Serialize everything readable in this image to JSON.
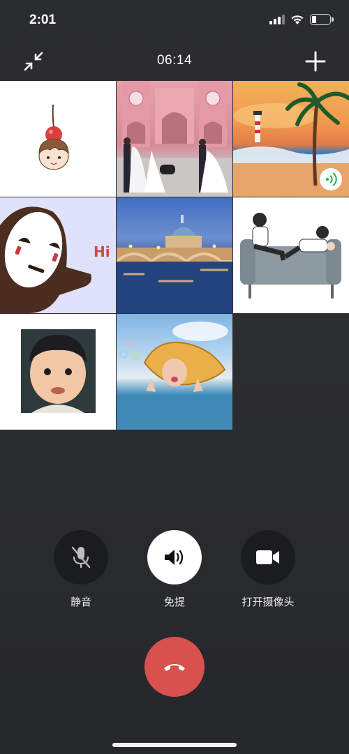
{
  "status_bar": {
    "time": "2:01"
  },
  "header": {
    "timer": "06:14"
  },
  "controls": {
    "mute_label": "静音",
    "speaker_label": "免提",
    "camera_label": "打开摄像头"
  },
  "tiles": [
    {
      "name": "participant-tile-cherry-boy",
      "bubble_text": ""
    },
    {
      "name": "participant-tile-wedding-castle",
      "bubble_text": ""
    },
    {
      "name": "participant-tile-beach-sunset",
      "speaking": true
    },
    {
      "name": "participant-tile-no-face",
      "bubble_text": "Hi"
    },
    {
      "name": "participant-tile-river-dome",
      "bubble_text": ""
    },
    {
      "name": "participant-tile-couple-sofa",
      "bubble_text": ""
    },
    {
      "name": "participant-tile-toddler",
      "bubble_text": ""
    },
    {
      "name": "participant-tile-fish-hat",
      "bubble_text": ""
    }
  ],
  "colors": {
    "background": "#2b2c30",
    "hangup": "#d9514e",
    "speaking_indicator": "#2fb54a"
  }
}
